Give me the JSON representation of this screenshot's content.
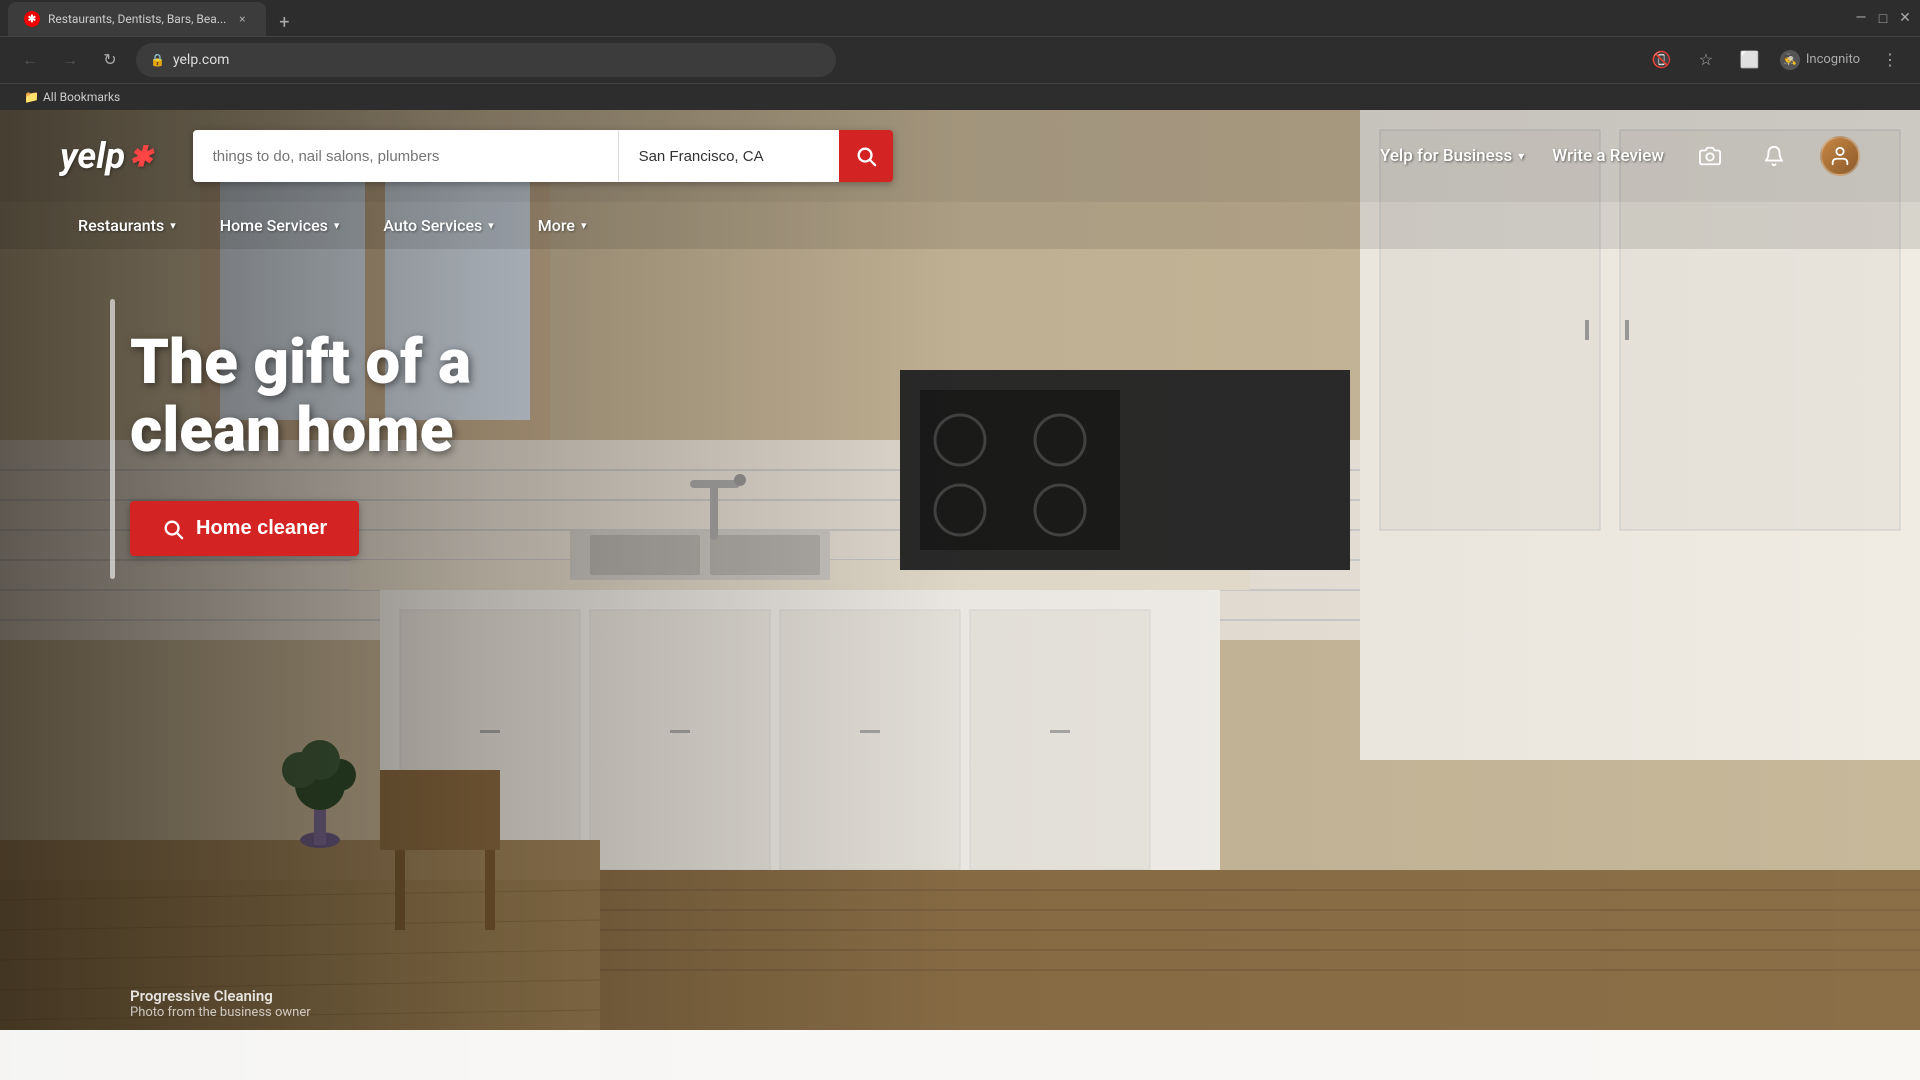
{
  "browser": {
    "tab": {
      "title": "Restaurants, Dentists, Bars, Bea...",
      "favicon": "✱",
      "close_label": "×"
    },
    "new_tab_label": "+",
    "address": "yelp.com",
    "back_label": "←",
    "forward_label": "→",
    "reload_label": "↻",
    "incognito_label": "Incognito",
    "bookmarks_label": "All Bookmarks",
    "window_controls": {
      "minimize": "—",
      "maximize": "□",
      "close": "✕"
    }
  },
  "yelp": {
    "logo_text": "yelp",
    "logo_burst": "✱",
    "search": {
      "what_placeholder": "things to do, nail salons, plumbers",
      "where_value": "San Francisco, CA",
      "button_label": "🔍"
    },
    "header": {
      "yelp_for_business": "Yelp for Business",
      "write_review": "Write a Review"
    },
    "nav": {
      "items": [
        {
          "label": "Restaurants",
          "has_dropdown": true
        },
        {
          "label": "Home Services",
          "has_dropdown": true
        },
        {
          "label": "Auto Services",
          "has_dropdown": true
        },
        {
          "label": "More",
          "has_dropdown": true
        }
      ]
    },
    "hero": {
      "title": "The gift of a clean home",
      "cta_label": "Home cleaner"
    },
    "photo_credit": {
      "name": "Progressive Cleaning",
      "subtitle": "Photo from the business owner"
    }
  }
}
